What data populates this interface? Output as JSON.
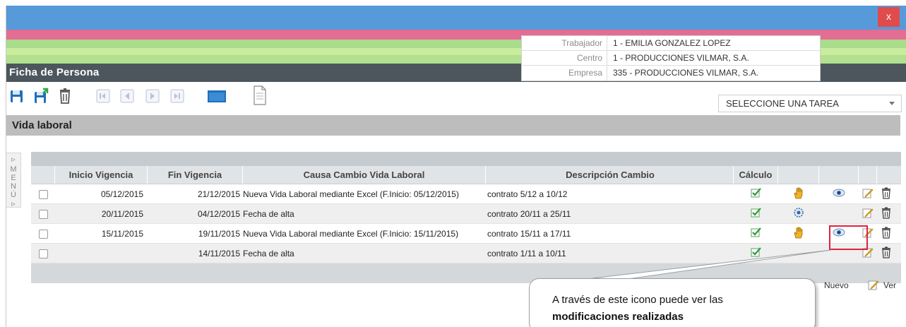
{
  "window": {
    "close_label": "x",
    "title": "Ficha de Persona"
  },
  "info": [
    {
      "label": "Trabajador",
      "value": "1 - EMILIA GONZALEZ LOPEZ"
    },
    {
      "label": "Centro",
      "value": "1 - PRODUCCIONES VILMAR, S.A."
    },
    {
      "label": "Empresa",
      "value": "335 - PRODUCCIONES VILMAR, S.A."
    }
  ],
  "toolbar": {
    "icons": [
      "save-icon",
      "save-new-icon",
      "trash-icon",
      "first-record-icon",
      "prev-record-icon",
      "next-record-icon",
      "last-record-icon",
      "window-icon",
      "document-icon"
    ],
    "task_select": "SELECCIONE UNA TAREA"
  },
  "section": {
    "title": "Vida laboral"
  },
  "side_menu": {
    "label": "MENÚ"
  },
  "grid": {
    "columns": [
      "",
      "Inicio Vigencia",
      "Fin Vigencia",
      "Causa Cambio Vida Laboral",
      "Descripción Cambio",
      "Cálculo",
      "",
      "",
      "",
      ""
    ],
    "rows": [
      {
        "inicio": "05/12/2015",
        "fin": "21/12/2015",
        "causa": "Nueva Vida Laboral mediante Excel (F.Inicio: 05/12/2015)",
        "desc": "contrato 5/12 a 10/12"
      },
      {
        "inicio": "20/11/2015",
        "fin": "04/12/2015",
        "causa": "Fecha de alta",
        "desc": "contrato 20/11 a 25/11"
      },
      {
        "inicio": "15/11/2015",
        "fin": "19/11/2015",
        "causa": "Nueva Vida Laboral mediante Excel (F.Inicio: 15/11/2015)",
        "desc": "contrato 15/11 a 17/11"
      },
      {
        "inicio": "",
        "fin": "14/11/2015",
        "causa": "Fecha de alta",
        "desc": "contrato 1/11 a 10/11"
      }
    ],
    "footer": {
      "nuevo": "Nuevo",
      "ver": "Ver"
    }
  },
  "callout": {
    "text_plain": "A través de este icono puede ver las",
    "text_bold": "modificaciones realizadas"
  },
  "colors": {
    "blue_band": "#569ad9",
    "pink_band": "#e46d93",
    "green_band": "#a9dc8b",
    "title_bar": "#4c565c",
    "close": "#e04b4b",
    "highlight": "#e0213f"
  }
}
